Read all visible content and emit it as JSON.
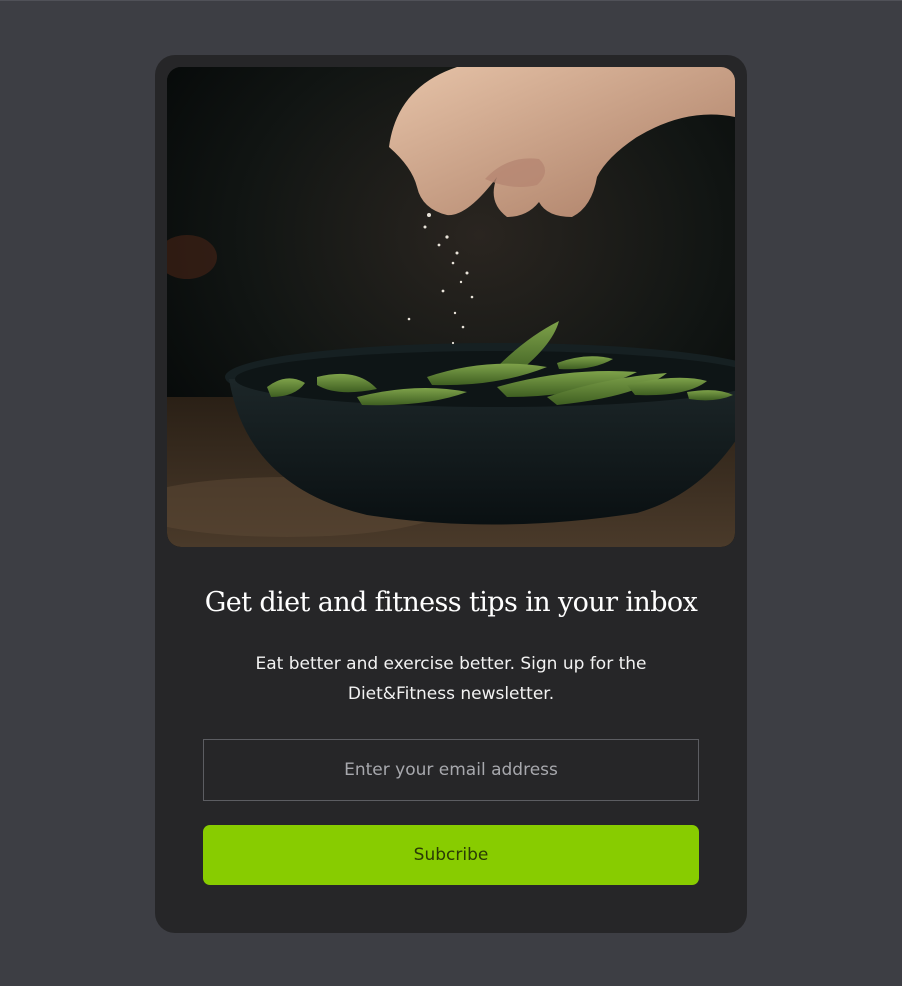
{
  "photo": {
    "alt": "Hand sprinkling salt over a dark bowl of green edamame pods"
  },
  "signup": {
    "headline": "Get diet and fitness tips in your inbox",
    "description": "Eat better and exercise better. Sign up for the Diet&Fitness newsletter.",
    "email_placeholder": "Enter your email address",
    "email_value": "",
    "button_label": "Subcribe"
  },
  "colors": {
    "page_background": "#3d3e44",
    "card_background": "#262628",
    "accent": "#88cc00"
  }
}
